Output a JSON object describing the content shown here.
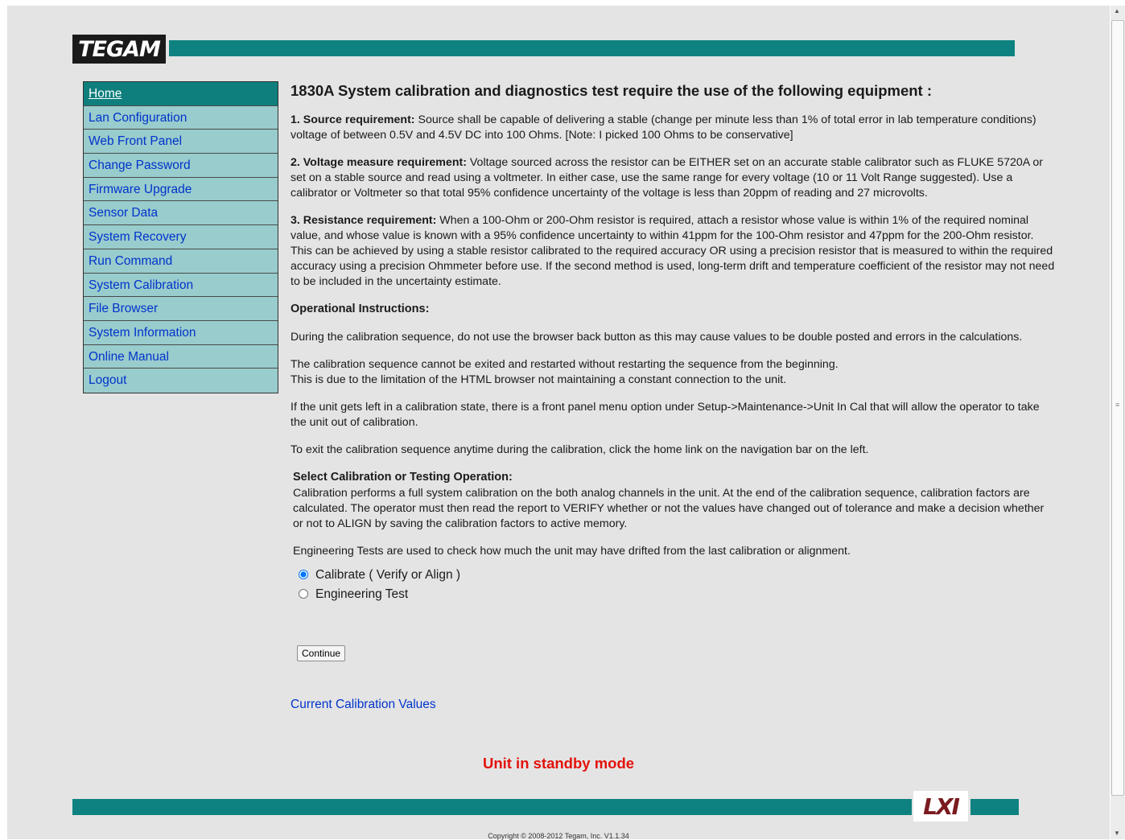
{
  "header": {
    "logo_text": "TEGAM"
  },
  "nav": {
    "items": [
      {
        "label": "Home",
        "active": true
      },
      {
        "label": "Lan Configuration"
      },
      {
        "label": "Web Front Panel"
      },
      {
        "label": "Change Password"
      },
      {
        "label": "Firmware Upgrade"
      },
      {
        "label": "Sensor Data"
      },
      {
        "label": "System Recovery"
      },
      {
        "label": "Run Command"
      },
      {
        "label": "System Calibration"
      },
      {
        "label": "File Browser"
      },
      {
        "label": "System Information"
      },
      {
        "label": "Online Manual"
      },
      {
        "label": "Logout"
      }
    ]
  },
  "main": {
    "title": "1830A System calibration and diagnostics test require the use of the following equipment :",
    "req1": {
      "label": "1. Source requirement:",
      "text": " Source shall be capable of delivering a stable (change per minute less than 1% of total error in lab temperature conditions) voltage of between 0.5V and 4.5V DC into 100 Ohms. [Note: I picked 100 Ohms to be conservative]"
    },
    "req2": {
      "label": "2. Voltage measure requirement:",
      "text": " Voltage sourced across the resistor can be EITHER set on an accurate stable calibrator such as FLUKE 5720A or set on a stable source and read using a voltmeter. In either case, use the same range for every voltage (10 or 11 Volt Range suggested). Use a calibrator or Voltmeter so that total 95% confidence uncertainty of the voltage is less than 20ppm of reading and 27 microvolts."
    },
    "req3": {
      "label": "3. Resistance requirement:",
      "text": " When a 100-Ohm or 200-Ohm resistor is required, attach a resistor whose value is within 1% of the required nominal value, and whose value is known with a 95% confidence uncertainty to within 41ppm for the 100-Ohm resistor and 47ppm for the 200-Ohm resistor. This can be achieved by using a stable resistor calibrated to the required accuracy OR using a precision resistor that is measured to within the required accuracy using a precision Ohmmeter before use. If the second method is used, long-term drift and temperature coefficient of the resistor may not need to be included in the uncertainty estimate."
    },
    "op_heading": "Operational Instructions:",
    "op1": "During the calibration sequence, do not use the browser back button as this may cause values to be double posted and errors in the calculations.",
    "op2_line1": "The calibration sequence cannot be exited and restarted without restarting the sequence from the beginning.",
    "op2_line2": "This is due to the limitation of the HTML browser not maintaining a constant connection to the unit.",
    "op3": "If the unit gets left in a calibration state, there is a front panel menu option under Setup->Maintenance->Unit In Cal that will allow the operator to take the unit out of calibration.",
    "op4": "To exit the calibration sequence anytime during the calibration, click the home link on the navigation bar on the left.",
    "select_heading": "Select Calibration or Testing Operation:",
    "select_desc": "Calibration performs a full system calibration on the both analog channels in the unit. At the end of the calibration sequence, calibration factors are calculated. The operator must then read the report to VERIFY whether or not the values have changed out of tolerance and make a decision whether or not to ALIGN by saving the calibration factors to active memory.",
    "eng_desc": "Engineering Tests are used to check how much the unit may have drifted from the last calibration or alignment.",
    "radio_calibrate": "Calibrate ( Verify or Align )",
    "radio_engineering": "Engineering Test",
    "selected_option": "Calibrate ( Verify or Align )",
    "continue_label": "Continue",
    "cal_values_link": "Current Calibration Values"
  },
  "status": {
    "text": "Unit in standby mode",
    "color": "#e3120b"
  },
  "footer": {
    "lxi_text": "LXI",
    "copyright": "Copyright © 2008-2012 Tegam, Inc. V1.1.34"
  },
  "colors": {
    "teal": "#0e8280",
    "nav_bg": "#99cccc",
    "link": "#0033cc"
  }
}
